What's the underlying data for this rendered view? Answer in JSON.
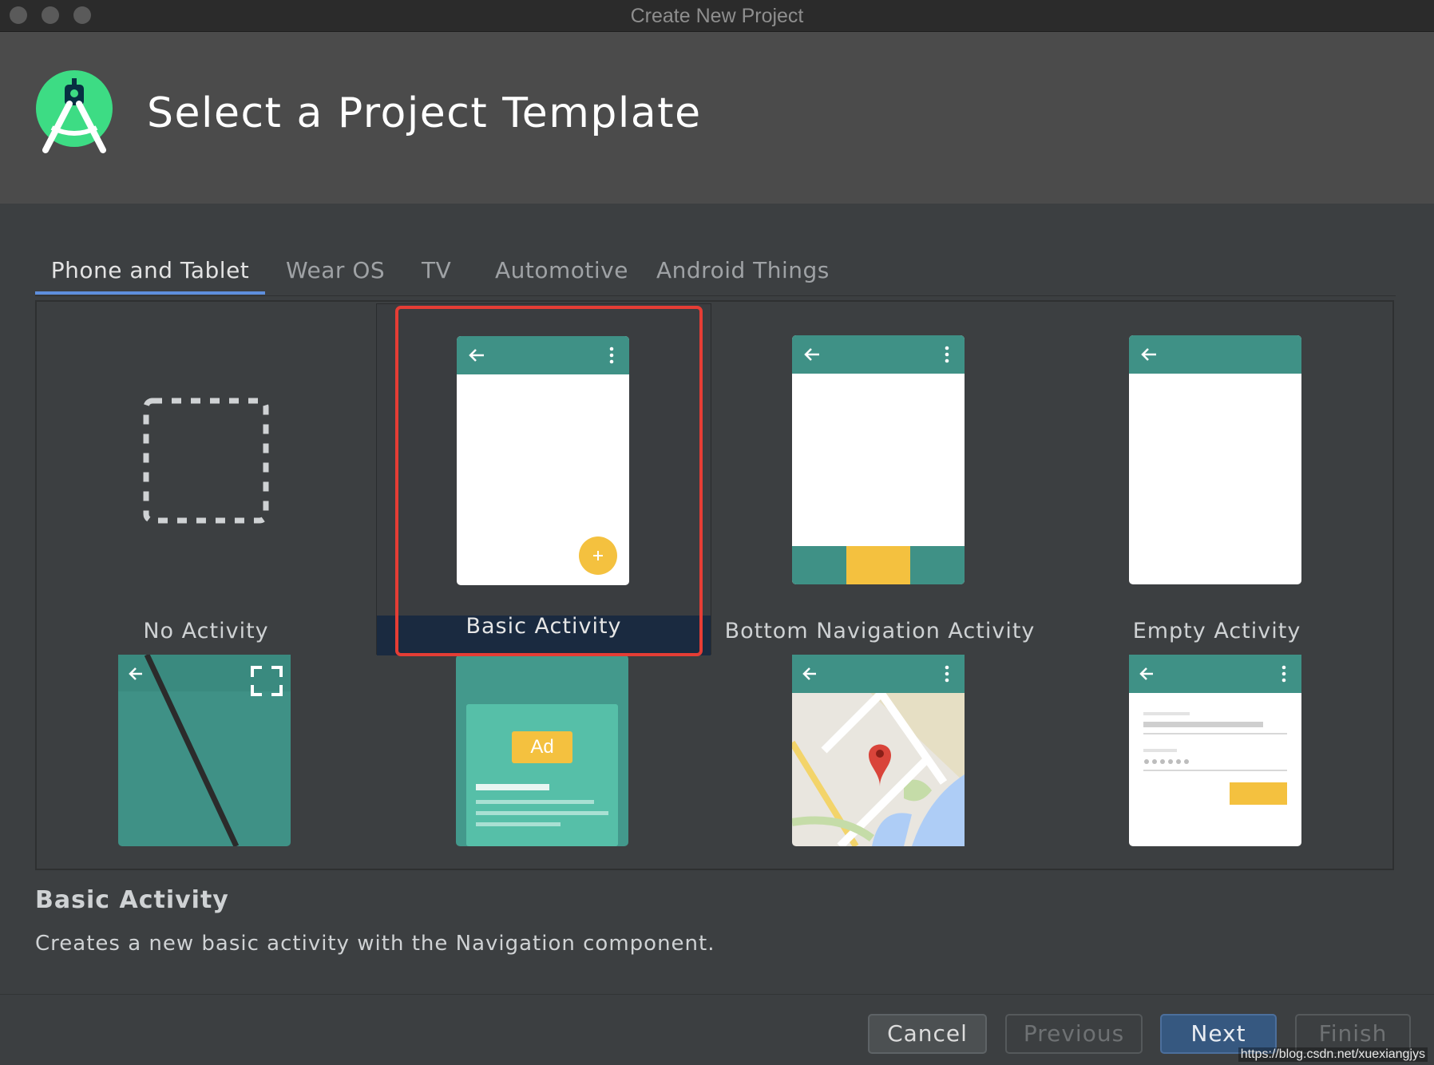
{
  "window": {
    "title": "Create New Project"
  },
  "header": {
    "title": "Select a Project Template"
  },
  "tabs": [
    {
      "label": "Phone and Tablet",
      "active": true
    },
    {
      "label": "Wear OS",
      "active": false
    },
    {
      "label": "TV",
      "active": false
    },
    {
      "label": "Automotive",
      "active": false
    },
    {
      "label": "Android Things",
      "active": false
    }
  ],
  "templates": [
    {
      "label": "No Activity"
    },
    {
      "label": "Basic Activity",
      "selected": true
    },
    {
      "label": "Bottom Navigation Activity"
    },
    {
      "label": "Empty Activity"
    },
    {
      "label": ""
    },
    {
      "label": ""
    },
    {
      "label": ""
    },
    {
      "label": ""
    }
  ],
  "previews": {
    "ad_label": "Ad"
  },
  "description": {
    "title": "Basic Activity",
    "text": "Creates a new basic activity with the Navigation component."
  },
  "buttons": {
    "cancel": "Cancel",
    "previous": "Previous",
    "next": "Next",
    "finish": "Finish"
  },
  "watermark": "https://blog.csdn.net/xuexiangjys",
  "colors": {
    "toolbar": "#3f9186",
    "accent_yellow": "#f4c13f",
    "selection_outline": "#e53d35",
    "primary_button": "#365880",
    "tab_underline": "#5e8fdd"
  },
  "icons": [
    "android-studio-logo",
    "back-arrow-icon",
    "more-vert-icon",
    "plus-icon",
    "fullscreen-icon",
    "map-pin-icon"
  ]
}
